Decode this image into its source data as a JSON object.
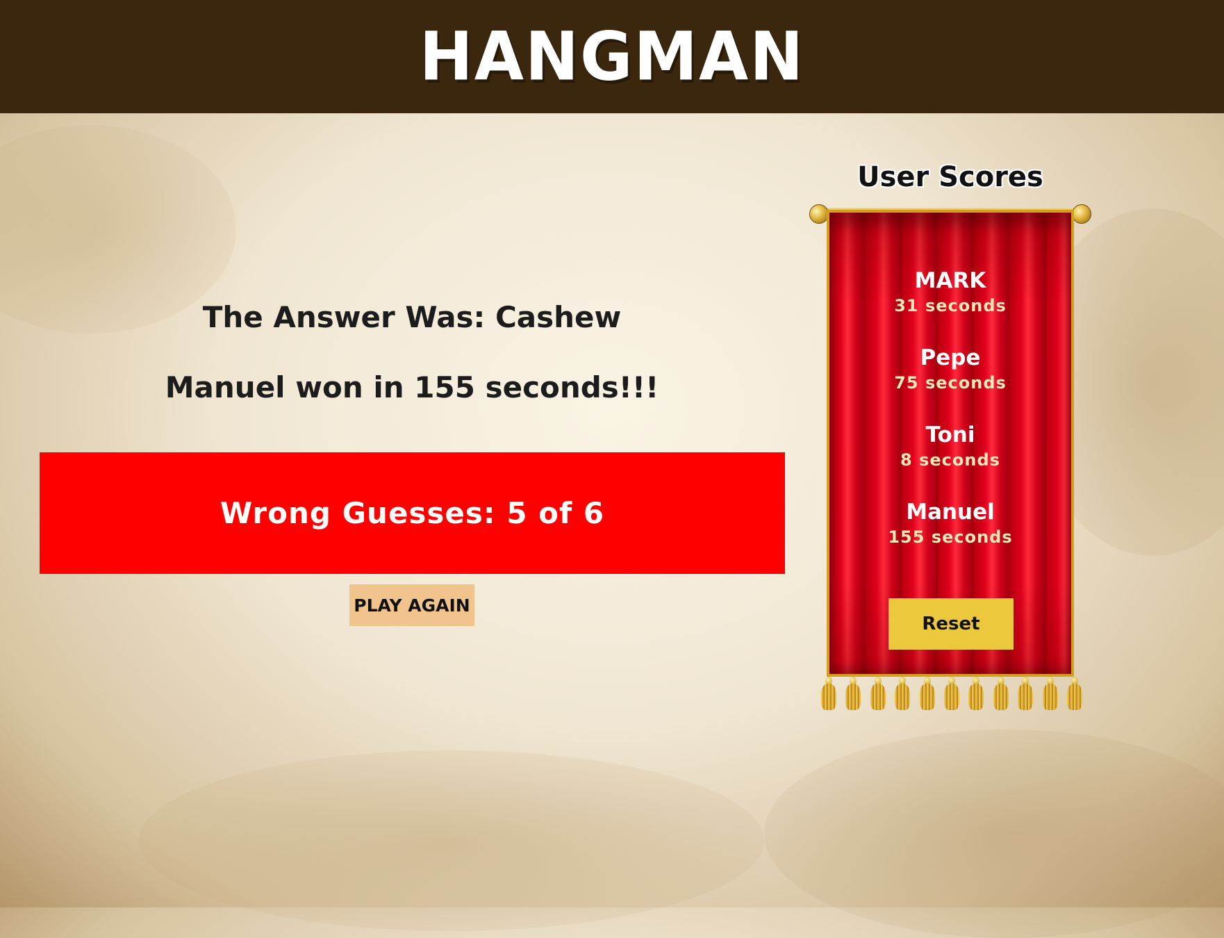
{
  "header": {
    "title": "Hangman"
  },
  "result": {
    "answer_text": "The answer was: cashew",
    "winner_text": "Manuel won in 155 seconds!!!"
  },
  "guesses": {
    "text": "Wrong Guesses: 5 of 6",
    "wrong": 5,
    "max": 6
  },
  "controls": {
    "play_again_label": "PLAY AGAIN"
  },
  "scores": {
    "title": "User Scores",
    "entries": [
      {
        "name": "MARK",
        "time": "31 seconds"
      },
      {
        "name": "Pepe",
        "time": "75 seconds"
      },
      {
        "name": "Toni",
        "time": "8 seconds"
      },
      {
        "name": "Manuel",
        "time": "155 seconds"
      }
    ],
    "reset_label": "Reset"
  },
  "colors": {
    "header_bg": "#3b270d",
    "guess_panel_bg": "#ff0000",
    "play_again_bg": "#f1c48e",
    "banner_red": "#c4001a",
    "reset_bg": "#ecc93c"
  }
}
